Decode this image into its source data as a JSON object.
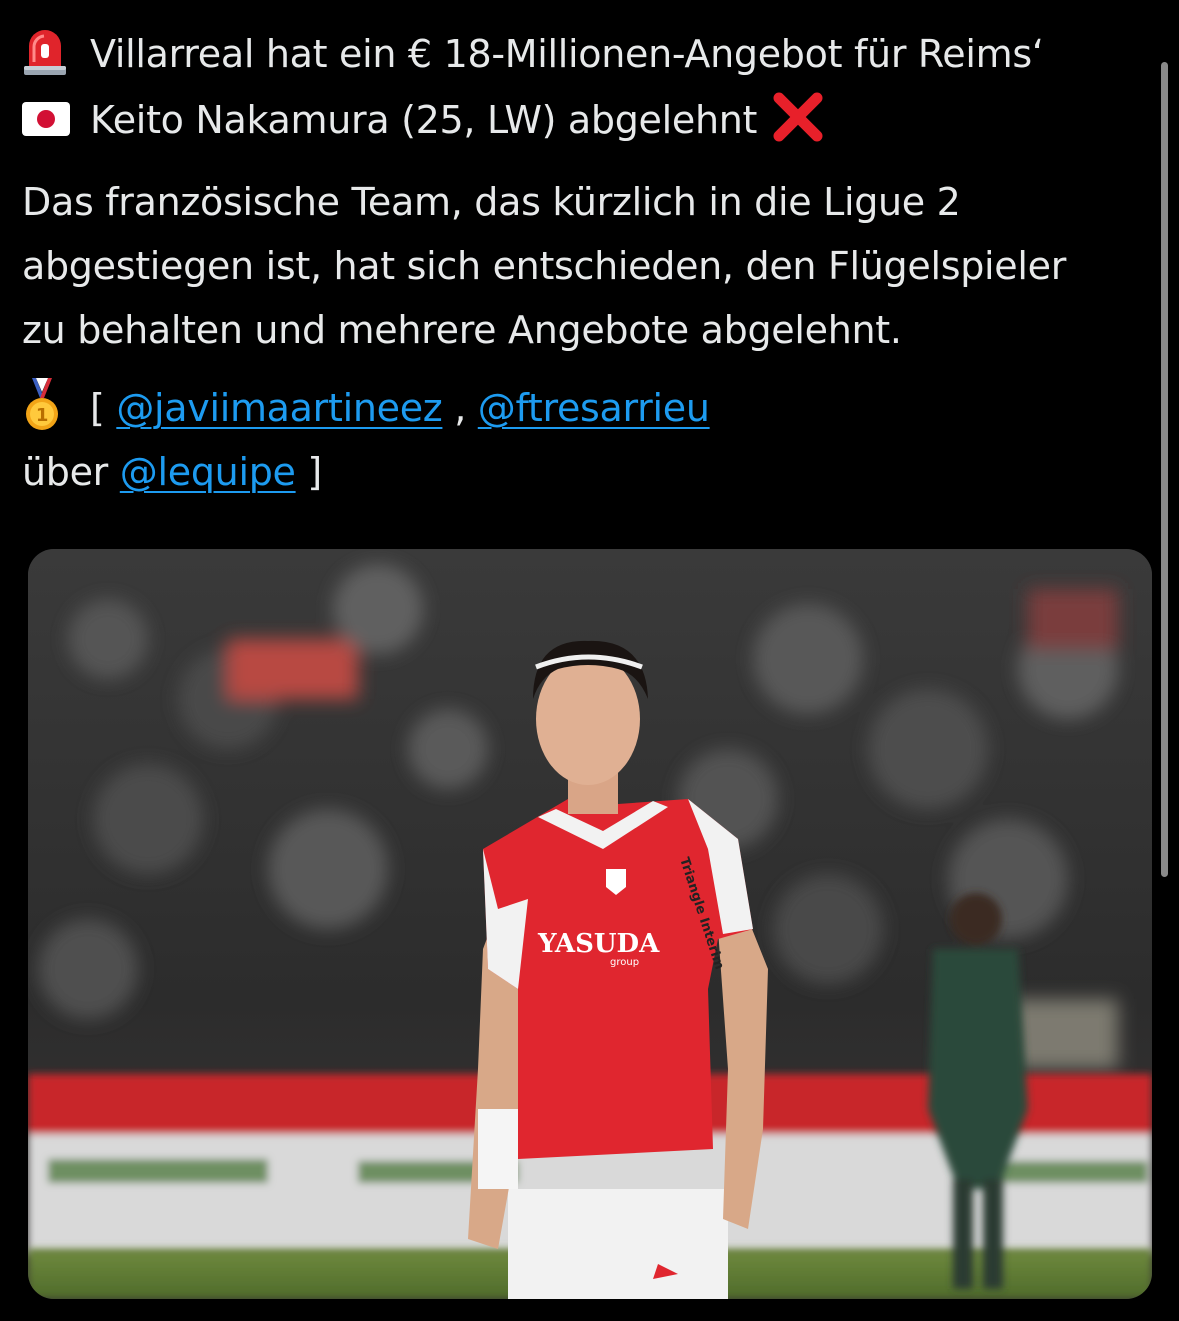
{
  "tweet": {
    "headline_line1": "Villarreal hat ein € 18-Millionen-Angebot für Reims‘",
    "headline_line2": "Keito Nakamura (25, LW) abgelehnt",
    "body_line1": "Das französische Team, das kürzlich in die Ligue 2",
    "body_line2": "abgestiegen ist, hat sich entschieden, den Flügelspieler",
    "body_line3": "zu behalten und mehrere Angebote abgelehnt.",
    "credit_open": "[",
    "mention1": "@javiimaartineez",
    "separator": ",",
    "mention2": "@ftresarrieu",
    "via_label": "über",
    "mention3": "@lequipe",
    "credit_close": "]"
  },
  "icons": {
    "siren": "rotating-light-icon",
    "flag": "japan-flag-icon",
    "cross": "cross-mark-icon",
    "medal": "first-place-medal-icon"
  },
  "media": {
    "jersey_sponsor": "YASUDA",
    "jersey_sponsor_sub": "group",
    "sleeve_sponsor": "Triangle Interim"
  },
  "colors": {
    "background": "#000000",
    "text": "#e7e9ea",
    "link": "#1d9bf0",
    "jersey_red": "#e0262f"
  }
}
